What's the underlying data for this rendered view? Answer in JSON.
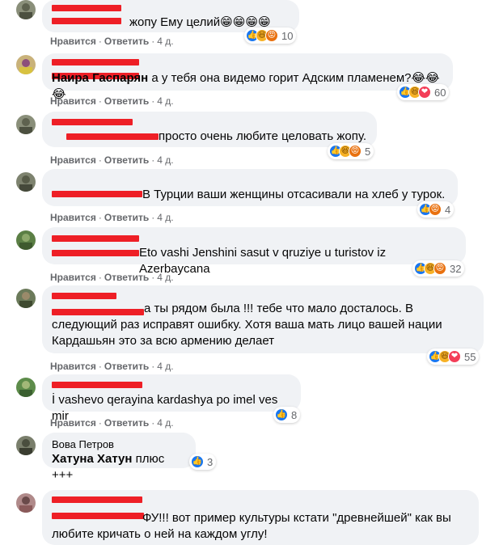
{
  "comments": [
    {
      "name": "",
      "text": "жопу Ему целий😁😁😁😁",
      "reactions": [
        "like",
        "haha",
        "angry"
      ],
      "reaction_count": "10",
      "like_label": "Нравится",
      "reply_label": "Ответить",
      "time": "4 д."
    },
    {
      "name": "",
      "tag": "Наира Гаспарян",
      "text": "а у тебя она видемо горит Адским пламенем?😂😂😂",
      "reactions": [
        "like",
        "haha",
        "love"
      ],
      "reaction_count": "60",
      "like_label": "Нравится",
      "reply_label": "Ответить",
      "time": "4 д."
    },
    {
      "name": "",
      "text": "просто очень любите целовать жопу.",
      "reactions": [
        "like",
        "haha",
        "angry"
      ],
      "reaction_count": "5",
      "like_label": "Нравится",
      "reply_label": "Ответить",
      "time": "4 д."
    },
    {
      "name": "",
      "text": "В Турции ваши женщины отсасивали на хлеб у турок.",
      "reactions": [
        "like",
        "angry"
      ],
      "reaction_count": "4",
      "like_label": "Нравится",
      "reply_label": "Ответить",
      "time": "4 д."
    },
    {
      "name": "",
      "text": "Eto vashi Jenshini sasut v qruziye u turistov iz Azerbaycana",
      "reactions": [
        "like",
        "haha",
        "angry"
      ],
      "reaction_count": "32",
      "like_label": "Нравится",
      "reply_label": "Ответить",
      "time": "4 д."
    },
    {
      "name": "",
      "text": "а ты рядом была !!! тебе что мало досталось. В следующий раз исправят ошибку. Хотя ваша мать лицо вашей нации Кардашьян это за всю армению делает",
      "reactions": [
        "like",
        "haha",
        "love"
      ],
      "reaction_count": "55",
      "like_label": "Нравится",
      "reply_label": "Ответить",
      "time": "4 д."
    },
    {
      "name": "",
      "text": "İ vashevo qerayina kardashya po imel ves mir",
      "reactions": [
        "like"
      ],
      "reaction_count": "8",
      "like_label": "Нравится",
      "reply_label": "Ответить",
      "time": "4 д."
    },
    {
      "name": "Вова Петров",
      "tag": "Хатуна Хатун",
      "text": "плюс +++",
      "reactions": [
        "like"
      ],
      "reaction_count": "3",
      "like_label": "",
      "reply_label": "",
      "time": ""
    },
    {
      "name": "",
      "text": "ФУ!!! вот пример культуры кстати \"древнейшей\" как вы любите кричать о ней на каждом углу!",
      "reactions": [],
      "reaction_count": "",
      "like_label": "",
      "reply_label": "",
      "time": ""
    }
  ],
  "reaction_icons": {
    "like": "thumbs-up-icon",
    "haha": "laughing-face-icon",
    "angry": "angry-face-icon",
    "love": "heart-icon"
  },
  "colors": {
    "bubble": "#f0f2f5",
    "meta": "#65676b",
    "like": "#1877f2",
    "haha": "#f7b125",
    "angry": "#e9710f",
    "love": "#f33e58",
    "redaction": "#ee1f26"
  }
}
